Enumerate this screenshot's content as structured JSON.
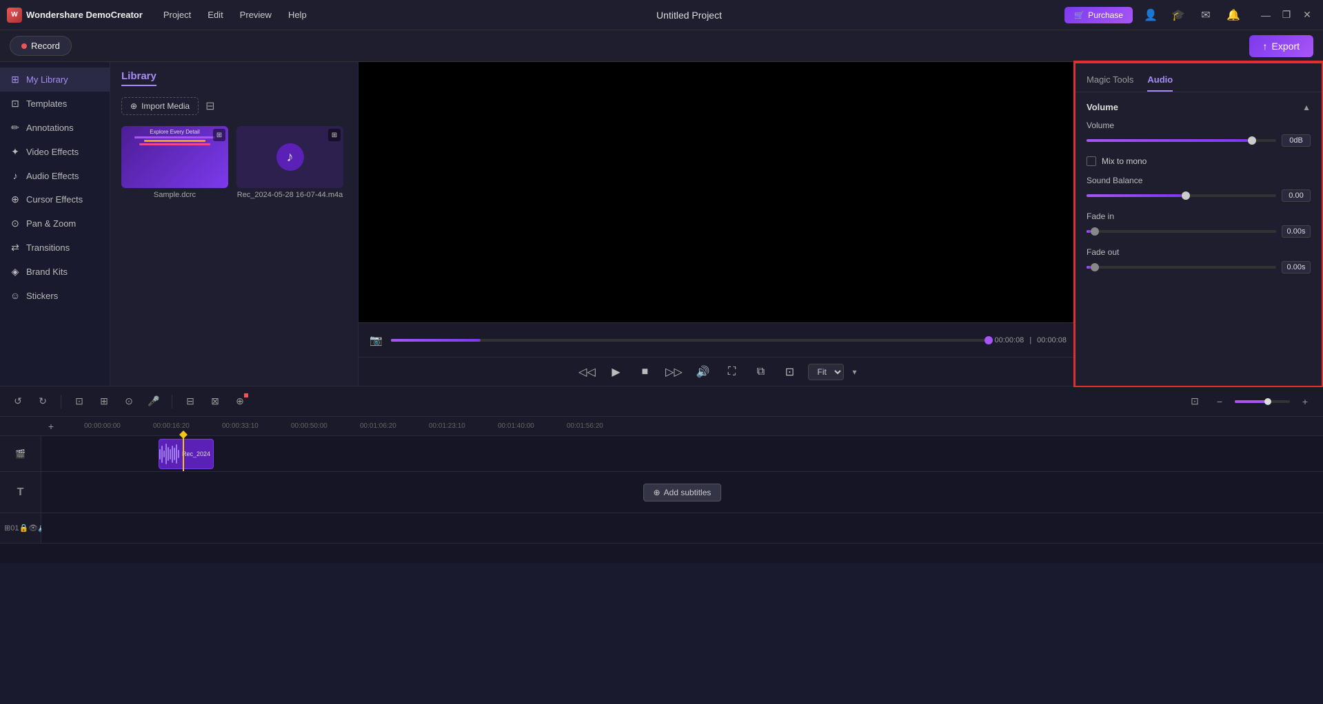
{
  "app": {
    "name": "Wondershare DemoCreator",
    "project_title": "Untitled Project"
  },
  "topbar": {
    "menu_items": [
      "Project",
      "Edit",
      "Preview",
      "Help"
    ],
    "purchase_label": "Purchase",
    "window_controls": [
      "–",
      "❐",
      "✕"
    ]
  },
  "second_row": {
    "record_label": "Record",
    "export_label": "Export"
  },
  "sidebar": {
    "items": [
      {
        "id": "my-library",
        "label": "My Library",
        "icon": "⊞",
        "active": true
      },
      {
        "id": "templates",
        "label": "Templates",
        "icon": "⊡"
      },
      {
        "id": "annotations",
        "label": "Annotations",
        "icon": "✏"
      },
      {
        "id": "video-effects",
        "label": "Video Effects",
        "icon": "✦"
      },
      {
        "id": "audio-effects",
        "label": "Audio Effects",
        "icon": "♪"
      },
      {
        "id": "cursor-effects",
        "label": "Cursor Effects",
        "icon": "⊕"
      },
      {
        "id": "pan-zoom",
        "label": "Pan & Zoom",
        "icon": "⊙"
      },
      {
        "id": "transitions",
        "label": "Transitions",
        "icon": "⇄"
      },
      {
        "id": "brand-kits",
        "label": "Brand Kits",
        "icon": "◈"
      },
      {
        "id": "stickers",
        "label": "Stickers",
        "icon": "☺"
      }
    ]
  },
  "library": {
    "tab_label": "Library",
    "import_media_label": "Import Media",
    "media_items": [
      {
        "id": "sample",
        "name": "Sample.dcrc",
        "type": "document"
      },
      {
        "id": "rec",
        "name": "Rec_2024-05-28 16-07-44.m4a",
        "type": "audio"
      }
    ]
  },
  "playback": {
    "current_time": "00:00:08",
    "total_time": "00:00:08",
    "fit_label": "Fit"
  },
  "right_panel": {
    "tabs": [
      {
        "id": "magic-tools",
        "label": "Magic Tools",
        "active": false
      },
      {
        "id": "audio",
        "label": "Audio",
        "active": true
      }
    ],
    "volume_section": {
      "title": "Volume",
      "volume_label": "Volume",
      "volume_value": "0dB",
      "volume_pct": 85,
      "mix_to_mono_label": "Mix to mono",
      "mix_to_mono_checked": false,
      "sound_balance_label": "Sound Balance",
      "sound_balance_value": "0.00",
      "sound_balance_pct": 50,
      "fade_in_label": "Fade in",
      "fade_in_value": "0.00s",
      "fade_in_pct": 2,
      "fade_out_label": "Fade out",
      "fade_out_value": "0.00s",
      "fade_out_pct": 2
    }
  },
  "timeline": {
    "ruler_marks": [
      "00:00:00:00",
      "00:00:16:20",
      "00:00:33:10",
      "00:00:50:00",
      "00:01:06:20",
      "00:01:23:10",
      "00:01:40:00",
      "00:01:56:20"
    ],
    "add_subtitle_label": "Add subtitles",
    "video_clip_label": "Rec_2024",
    "track_icons": [
      "⊞",
      "🔒",
      "👁",
      "🔊"
    ]
  },
  "colors": {
    "accent": "#a855f7",
    "accent_dark": "#7c3aed",
    "red_border": "#e03030",
    "playhead": "#f5c518",
    "bg_dark": "#1a1a2e",
    "bg_panel": "#1e1e2e"
  }
}
